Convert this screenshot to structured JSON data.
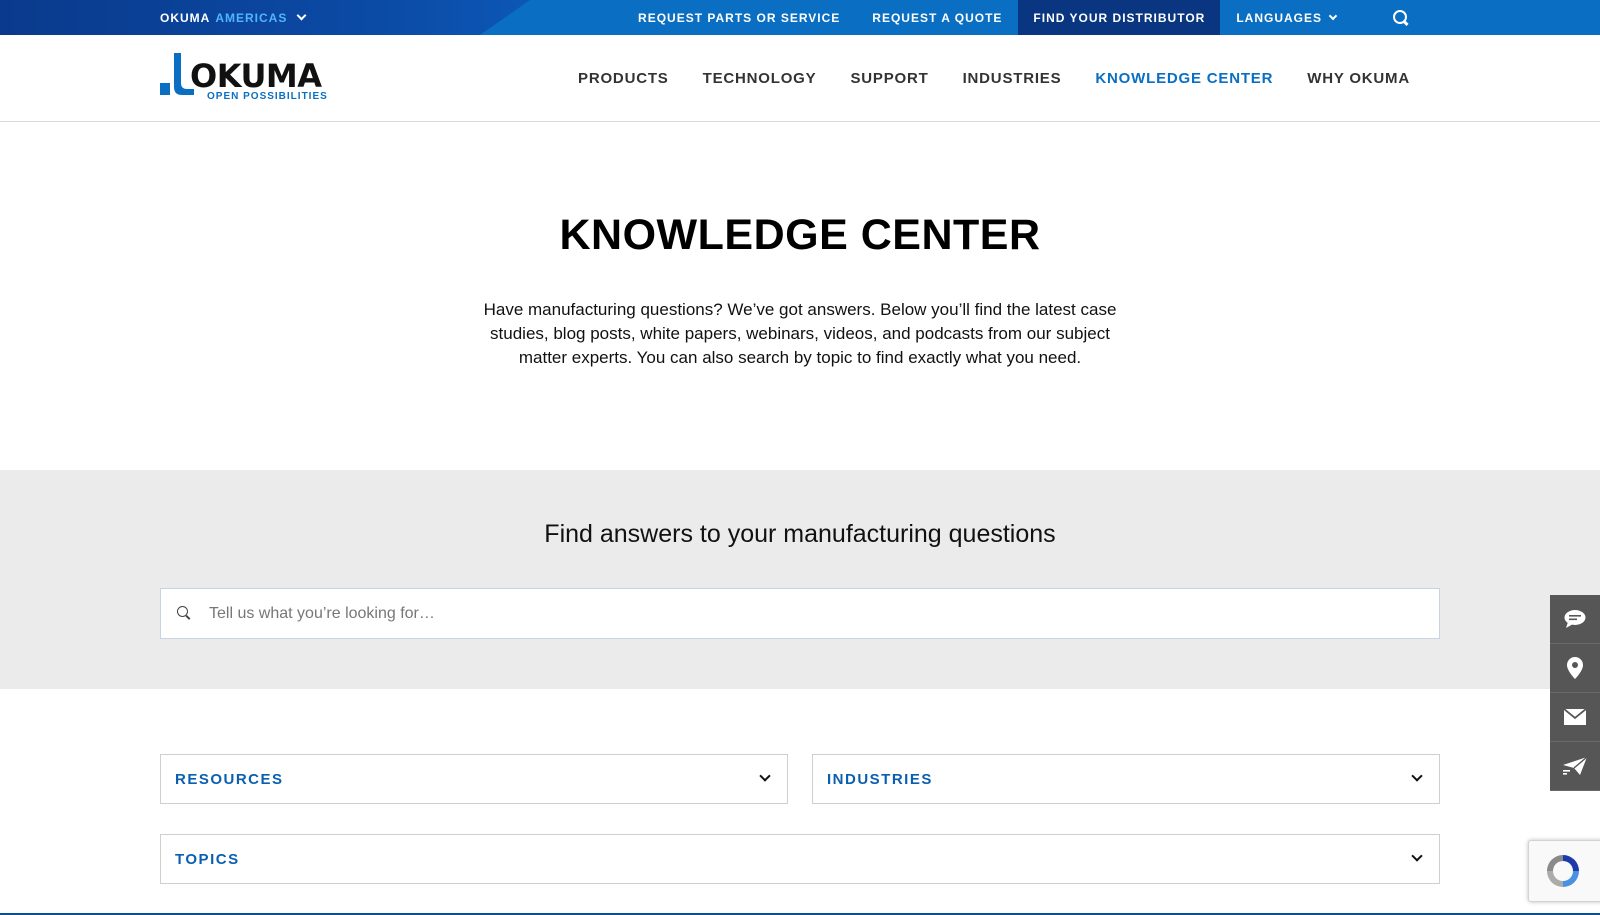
{
  "topbar": {
    "region_brand": "OKUMA",
    "region_name": "AMERICAS",
    "links": [
      {
        "label": "REQUEST PARTS OR SERVICE"
      },
      {
        "label": "REQUEST A QUOTE"
      },
      {
        "label": "FIND YOUR DISTRIBUTOR"
      },
      {
        "label": "LANGUAGES"
      }
    ]
  },
  "header": {
    "logo_word": "OKUMA",
    "logo_tagline": "OPEN POSSIBILITIES",
    "nav": [
      {
        "label": "PRODUCTS"
      },
      {
        "label": "TECHNOLOGY"
      },
      {
        "label": "SUPPORT"
      },
      {
        "label": "INDUSTRIES"
      },
      {
        "label": "KNOWLEDGE CENTER",
        "active": true
      },
      {
        "label": "WHY OKUMA"
      }
    ]
  },
  "hero": {
    "title": "KNOWLEDGE CENTER",
    "description": "Have manufacturing questions? We’ve got answers. Below you’ll find the latest case studies, blog posts, white papers, webinars, videos, and podcasts from our subject matter experts. You can also search by topic to find exactly what you need."
  },
  "search": {
    "heading": "Find answers to your manufacturing questions",
    "placeholder": "Tell us what you’re looking for…",
    "value": ""
  },
  "filters": {
    "resources": "RESOURCES",
    "industries": "INDUSTRIES",
    "topics": "TOPICS"
  },
  "side_icons": [
    "chat-icon",
    "location-pin-icon",
    "mail-icon",
    "send-icon"
  ],
  "colors": {
    "brand_blue": "#0a6fc2",
    "brand_dark_blue": "#0a3580",
    "filter_label": "#0a5fb0",
    "band_bg": "#ebebeb",
    "side_bar": "#565656"
  }
}
